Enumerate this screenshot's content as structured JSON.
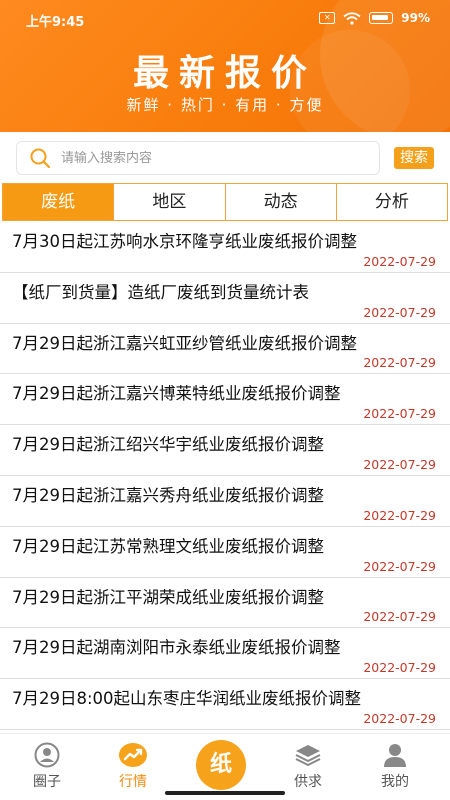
{
  "status": {
    "time": "上午9:45",
    "battery": "99"
  },
  "header": {
    "title": "最新报价",
    "subtitle": "新鲜 · 热门 · 有用 · 方便"
  },
  "search": {
    "placeholder": "请输入搜索内容",
    "button": "搜索"
  },
  "tabs": [
    {
      "label": "废纸",
      "active": true
    },
    {
      "label": "地区",
      "active": false
    },
    {
      "label": "动态",
      "active": false
    },
    {
      "label": "分析",
      "active": false
    }
  ],
  "items": [
    {
      "title": "7月30日起江苏响水京环隆亨纸业废纸报价调整",
      "date": "2022-07-29"
    },
    {
      "title": "【纸厂到货量】造纸厂废纸到货量统计表",
      "date": "2022-07-29"
    },
    {
      "title": "7月29日起浙江嘉兴虹亚纱管纸业废纸报价调整",
      "date": "2022-07-29"
    },
    {
      "title": "7月29日起浙江嘉兴博莱特纸业废纸报价调整",
      "date": "2022-07-29"
    },
    {
      "title": "7月29日起浙江绍兴华宇纸业废纸报价调整",
      "date": "2022-07-29"
    },
    {
      "title": "7月29日起浙江嘉兴秀舟纸业废纸报价调整",
      "date": "2022-07-29"
    },
    {
      "title": "7月29日起江苏常熟理文纸业废纸报价调整",
      "date": "2022-07-29"
    },
    {
      "title": "7月29日起浙江平湖荣成纸业废纸报价调整",
      "date": "2022-07-29"
    },
    {
      "title": "7月29日起湖南浏阳市永泰纸业废纸报价调整",
      "date": "2022-07-29"
    },
    {
      "title": "7月29日8:00起山东枣庄华润纸业废纸报价调整",
      "date": "2022-07-29"
    }
  ],
  "tabbar": {
    "quanzi": "圈子",
    "hangqing": "行情",
    "center": "纸",
    "gongqiu": "供求",
    "wode": "我的"
  },
  "colors": {
    "accent": "#f59a12",
    "date": "#c23a2a"
  }
}
